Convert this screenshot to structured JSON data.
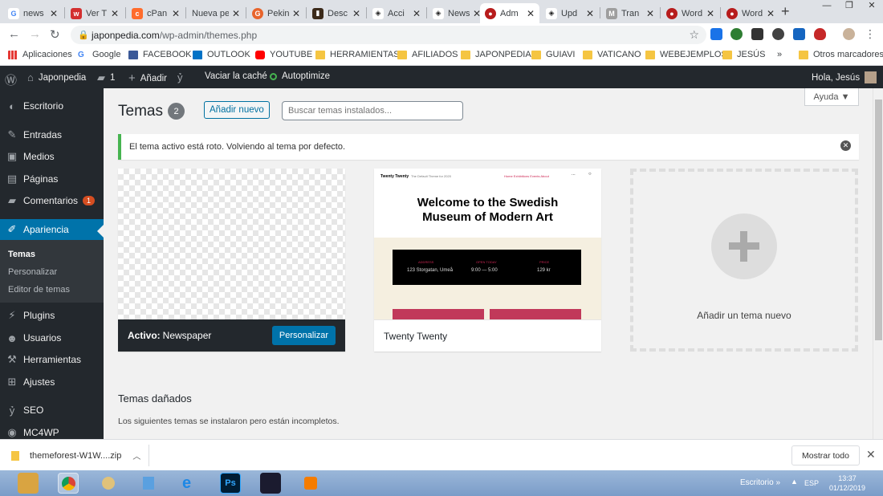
{
  "browser": {
    "tabs": [
      {
        "title": "news",
        "icon": "google-icon",
        "color": "#4285f4"
      },
      {
        "title": "Ver T",
        "icon": "w-icon",
        "color": "#d32f2f"
      },
      {
        "title": "cPan",
        "icon": "cpanel-icon",
        "color": "#ff6c2c"
      },
      {
        "title": "Nueva pe",
        "icon": "blank-icon",
        "color": "#dee1e6"
      },
      {
        "title": "Pekin",
        "icon": "g-icon",
        "color": "#e8642c"
      },
      {
        "title": "Desc",
        "icon": "book-icon",
        "color": "#3b2a1a"
      },
      {
        "title": "Acci",
        "icon": "eye-icon",
        "color": "#222222"
      },
      {
        "title": "News",
        "icon": "eye-icon",
        "color": "#222222"
      },
      {
        "title": "Adm",
        "icon": "avatar-icon",
        "color": "#b71c1c"
      },
      {
        "title": "Upd",
        "icon": "eye-icon",
        "color": "#222222"
      },
      {
        "title": "Tran",
        "icon": "m-icon",
        "color": "#9e9e9e"
      },
      {
        "title": "Word",
        "icon": "avatar-icon",
        "color": "#b71c1c"
      },
      {
        "title": "Word",
        "icon": "avatar-icon",
        "color": "#b71c1c"
      }
    ],
    "url_host": "japonpedia.com",
    "url_path": "/wp-admin/themes.php"
  },
  "bookmarks": [
    {
      "label": "Aplicaciones",
      "icon": "apps-grid-icon"
    },
    {
      "label": "Google",
      "icon": "google-icon"
    },
    {
      "label": "FACEBOOK",
      "icon": "facebook-icon"
    },
    {
      "label": "OUTLOOK",
      "icon": "outlook-icon"
    },
    {
      "label": "YOUTUBE",
      "icon": "youtube-icon"
    },
    {
      "label": "HERRAMIENTAS",
      "icon": "folder-icon"
    },
    {
      "label": "AFILIADOS",
      "icon": "folder-icon"
    },
    {
      "label": "JAPONPEDIA",
      "icon": "folder-icon"
    },
    {
      "label": "GUIAVI",
      "icon": "folder-icon"
    },
    {
      "label": "VATICANO",
      "icon": "folder-icon"
    },
    {
      "label": "WEBEJEMPLOS",
      "icon": "folder-icon"
    },
    {
      "label": "JESÚS",
      "icon": "folder-icon"
    }
  ],
  "bookmarks_overflow": "»",
  "bookmarks_other": "Otros marcadores",
  "adminbar": {
    "site": "Japonpedia",
    "comments_count": "1",
    "add": "Añadir",
    "cache": "Vaciar la caché",
    "autoptimize": "Autoptimize",
    "greeting": "Hola, Jesús"
  },
  "sidebar": {
    "items": [
      {
        "label": "Escritorio",
        "icon": "dashboard-icon"
      },
      {
        "label": "Entradas",
        "icon": "pin-icon"
      },
      {
        "label": "Medios",
        "icon": "media-icon"
      },
      {
        "label": "Páginas",
        "icon": "pages-icon"
      },
      {
        "label": "Comentarios",
        "icon": "comment-icon",
        "badge": "1"
      },
      {
        "label": "Apariencia",
        "icon": "brush-icon"
      },
      {
        "label": "Plugins",
        "icon": "plugin-icon"
      },
      {
        "label": "Usuarios",
        "icon": "users-icon"
      },
      {
        "label": "Herramientas",
        "icon": "tools-icon"
      },
      {
        "label": "Ajustes",
        "icon": "settings-icon"
      },
      {
        "label": "SEO",
        "icon": "yoast-icon"
      },
      {
        "label": "MC4WP",
        "icon": "mc4wp-icon"
      }
    ],
    "submenu": [
      "Temas",
      "Personalizar",
      "Editor de temas"
    ]
  },
  "main": {
    "title": "Temas",
    "count": "2",
    "add_new": "Añadir nuevo",
    "search_placeholder": "Buscar temas instalados...",
    "help": "Ayuda ▼",
    "notice": "El tema activo está roto. Volviendo al tema por defecto.",
    "active_label": "Activo:",
    "active_theme": "Newspaper",
    "customize": "Personalizar",
    "theme2": "Twenty Twenty",
    "add_theme": "Añadir un tema nuevo",
    "broken_title": "Temas dañados",
    "broken_desc": "Los siguientes temas se instalaron pero están incompletos."
  },
  "preview": {
    "site": "Twenty Twenty",
    "tagline": "The Default Theme for 2020",
    "nav": "Home  Exhibitions  Events  About",
    "headline_1": "Welcome to the Swedish",
    "headline_2": "Museum of Modern Art",
    "labels": [
      "ADDRESS",
      "OPEN TODAY",
      "PRICE"
    ],
    "values": [
      "123 Storgatan, Umeå",
      "9:00 — 5:00",
      "129 kr"
    ]
  },
  "download": {
    "filename": "themeforest-W1W....zip",
    "show_all": "Mostrar todo"
  },
  "taskbar": {
    "desktop": "Escritorio",
    "lang": "ESP",
    "time": "13:37",
    "date": "01/12/2019",
    "overflow": "»"
  },
  "colors": {
    "wp_dark": "#23282d",
    "wp_blue": "#0073aa",
    "notice_green": "#46b450"
  }
}
